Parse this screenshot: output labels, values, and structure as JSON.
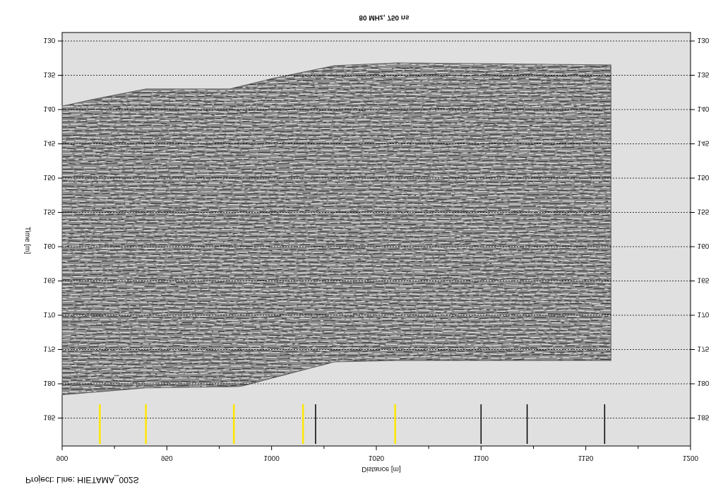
{
  "footer": {
    "project_label": "Project:",
    "line_label": "Line:",
    "line_name": "HIETAMA_002S"
  },
  "chart_data": {
    "type": "heatmap",
    "title": "80 MHz, 750 ns",
    "xlabel": "Distance [m]",
    "ylabel": "Time [m]",
    "x_ticks": [
      900,
      950,
      1000,
      1050,
      1100,
      1150,
      1200
    ],
    "x_tick_labels": [
      "900",
      "950",
      "1000",
      "1050",
      "1100",
      "1150",
      "1200"
    ],
    "y_ticks": [
      130,
      135,
      140,
      145,
      150,
      155,
      160,
      165,
      170,
      175,
      180,
      185
    ],
    "y_tick_labels": [
      "130",
      "135",
      "140",
      "145",
      "150",
      "155",
      "160",
      "165",
      "170",
      "175",
      "180",
      "185"
    ],
    "xlim": [
      900,
      1200
    ],
    "ylim": [
      130,
      187.5
    ],
    "grid": true,
    "reversed_labels": true,
    "colors": {
      "plot_background": "#e0e0e0",
      "marker_yellow": "#ffe600",
      "marker_black": "#000000"
    },
    "radargram": {
      "x_end": 1162,
      "top_surface": [
        [
          900,
          139.5
        ],
        [
          915,
          138.5
        ],
        [
          940,
          137.0
        ],
        [
          980,
          137.0
        ],
        [
          1000,
          135.5
        ],
        [
          1030,
          133.6
        ],
        [
          1060,
          133.2
        ],
        [
          1100,
          133.3
        ],
        [
          1162,
          133.5
        ]
      ],
      "bottom_surface": [
        [
          900,
          181.6
        ],
        [
          940,
          180.6
        ],
        [
          985,
          180.4
        ],
        [
          1005,
          178.8
        ],
        [
          1030,
          176.8
        ],
        [
          1060,
          176.6
        ],
        [
          1162,
          176.6
        ]
      ]
    },
    "markers": {
      "yellow_x": [
        918,
        940,
        982,
        1015,
        1059
      ],
      "black_x": [
        1021,
        1100,
        1122,
        1159
      ]
    }
  }
}
